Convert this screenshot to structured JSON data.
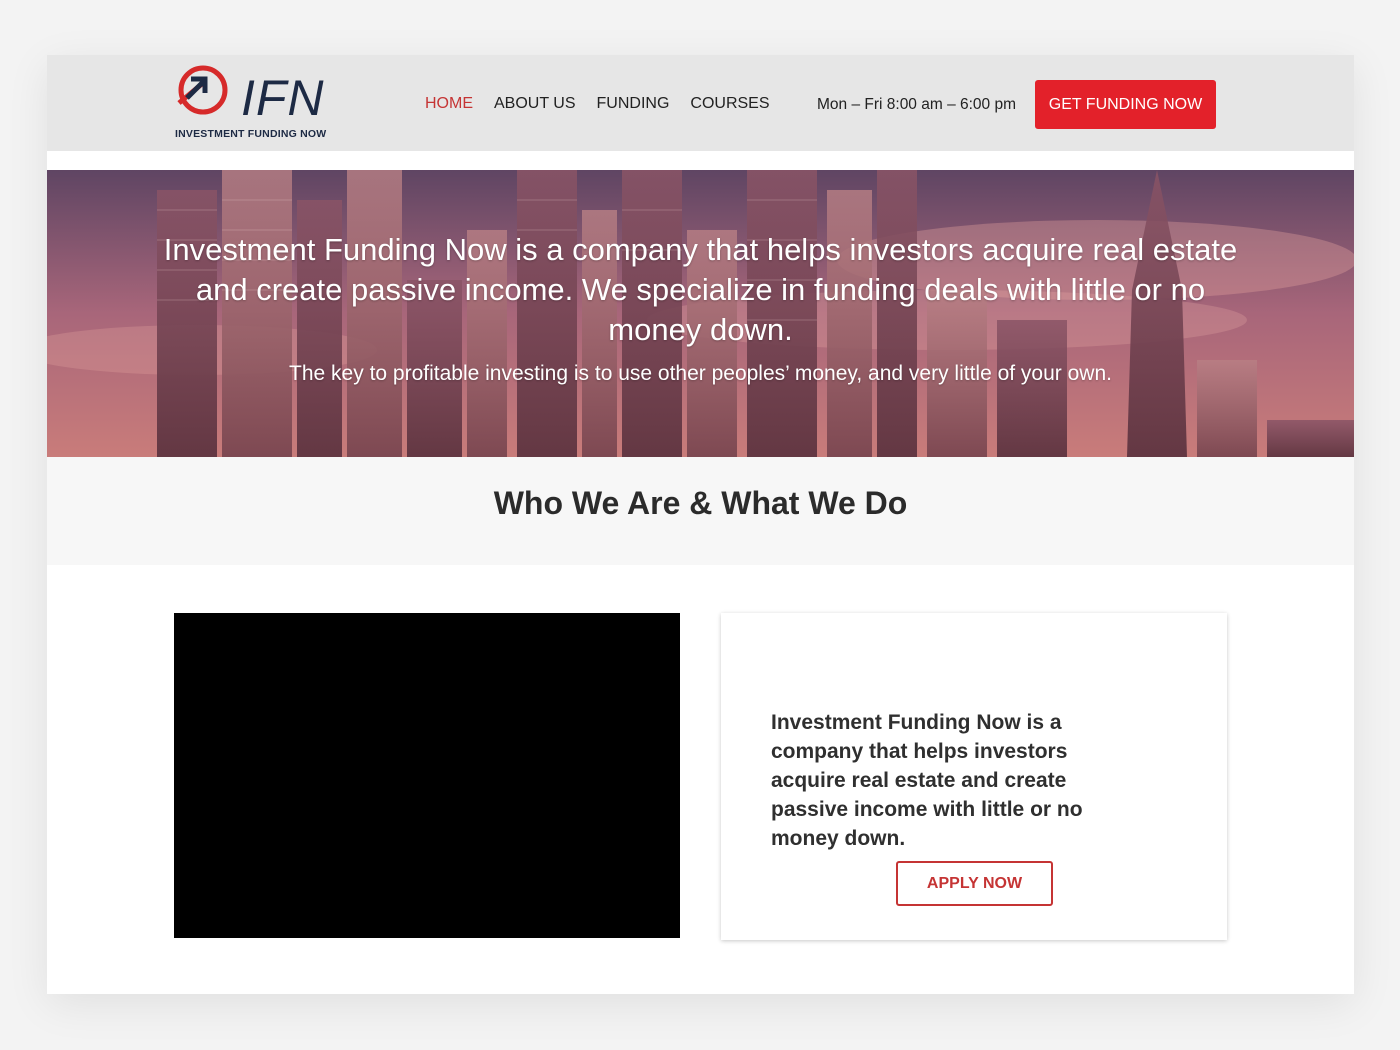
{
  "brand": {
    "logo_text": "IFN",
    "logo_subtitle": "INVESTMENT FUNDING NOW"
  },
  "nav": {
    "items": [
      {
        "label": "HOME",
        "active": true
      },
      {
        "label": "ABOUT US",
        "active": false
      },
      {
        "label": "FUNDING",
        "active": false
      },
      {
        "label": "COURSES",
        "active": false
      }
    ]
  },
  "header": {
    "hours": "Mon – Fri 8:00 am – 6:00 pm",
    "cta_label": "GET FUNDING NOW"
  },
  "hero": {
    "title": "Investment Funding Now is a company that helps investors acquire real estate and create passive income. We specialize in funding deals with little or no money down.",
    "subtitle": "The key to profitable investing is to use other peoples’ money, and very little of your own."
  },
  "section": {
    "heading": "Who We Are & What We Do"
  },
  "card": {
    "text": "Investment Funding Now is a company that helps investors acquire real estate and create passive income with little or no money down.",
    "button_label": "APPLY NOW"
  },
  "colors": {
    "accent": "#e3212a",
    "nav_active": "#c53434",
    "header_bg": "#e6e6e6",
    "logo_navy": "#1d2a44"
  }
}
